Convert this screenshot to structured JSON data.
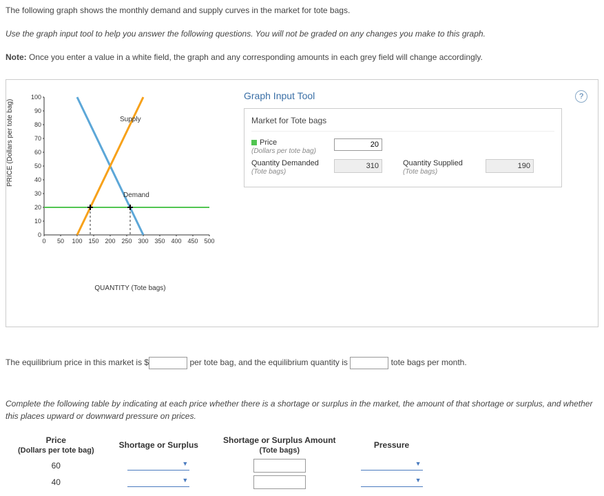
{
  "intro": {
    "line1": "The following graph shows the monthly demand and supply curves in the market for tote bags.",
    "line2_em": "Use the graph input tool to help you answer the following questions. You will not be graded on any changes you make to this graph.",
    "note_bold": "Note:",
    "note_rest": " Once you enter a value in a white field, the graph and any corresponding amounts in each grey field will change accordingly."
  },
  "chart": {
    "y_label": "PRICE (Dollars per tote bag)",
    "x_label": "QUANTITY (Tote bags)",
    "supply_label": "Supply",
    "demand_label": "Demand"
  },
  "chart_data": {
    "type": "line",
    "title": "",
    "xlabel": "QUANTITY (Tote bags)",
    "ylabel": "PRICE (Dollars per tote bag)",
    "xlim": [
      0,
      500
    ],
    "ylim": [
      0,
      100
    ],
    "xticks": [
      0,
      50,
      100,
      150,
      200,
      250,
      300,
      350,
      400,
      450,
      500
    ],
    "yticks": [
      0,
      10,
      20,
      30,
      40,
      50,
      60,
      70,
      80,
      90,
      100
    ],
    "series": [
      {
        "name": "Supply",
        "color": "#f7a11a",
        "points": [
          [
            100,
            0
          ],
          [
            300,
            100
          ]
        ]
      },
      {
        "name": "Demand",
        "color": "#5ca7d8",
        "points": [
          [
            100,
            100
          ],
          [
            300,
            0
          ]
        ]
      },
      {
        "name": "PriceLine",
        "color": "#51c551",
        "points": [
          [
            0,
            20
          ],
          [
            500,
            20
          ]
        ]
      }
    ],
    "markers": [
      {
        "x": 140,
        "y": 20,
        "style": "plus-black"
      },
      {
        "x": 260,
        "y": 20,
        "style": "plus-black"
      }
    ]
  },
  "tool": {
    "title": "Graph Input Tool",
    "subtitle": "Market for Tote bags",
    "price_label": "Price",
    "price_sub": "(Dollars per tote bag)",
    "price_value": "20",
    "qd_label": "Quantity Demanded",
    "qd_sub": "(Tote bags)",
    "qd_value": "310",
    "qs_label": "Quantity Supplied",
    "qs_sub": "(Tote bags)",
    "qs_value": "190"
  },
  "fillin": {
    "part1": "The equilibrium price in this market is ",
    "dollar": "$",
    "part2": " per tote bag, and the equilibrium quantity is ",
    "part3": " tote bags per month."
  },
  "question2": "Complete the following table by indicating at each price whether there is a shortage or surplus in the market, the amount of that shortage or surplus, and whether this places upward or downward pressure on prices.",
  "table": {
    "h_price": "Price",
    "h_price_sub": "(Dollars per tote bag)",
    "h_ss": "Shortage or Surplus",
    "h_amt": "Shortage or Surplus Amount",
    "h_amt_sub": "(Tote bags)",
    "h_pressure": "Pressure",
    "rows": [
      {
        "price": "60"
      },
      {
        "price": "40"
      }
    ]
  }
}
